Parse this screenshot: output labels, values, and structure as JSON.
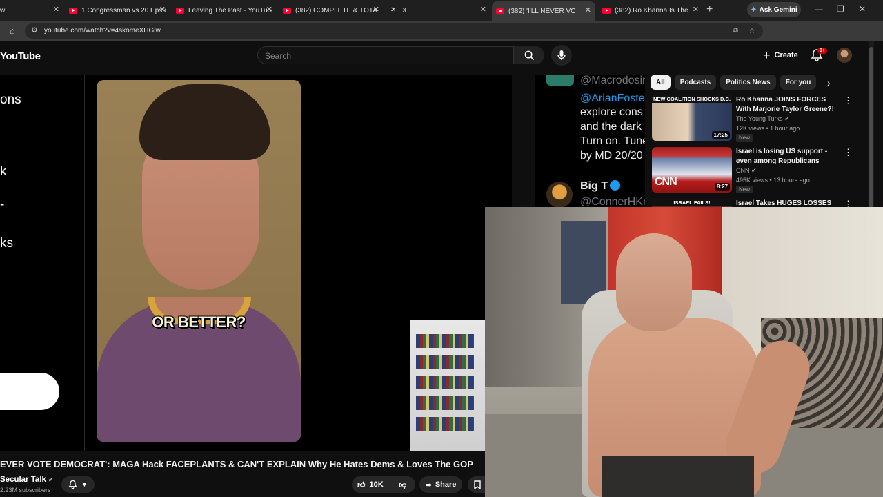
{
  "browser": {
    "tabs": [
      {
        "title": "w",
        "icon": "close-icon",
        "active": false
      },
      {
        "title": "1 Congressman vs 20 Epstein",
        "icon": "youtube-icon",
        "active": false
      },
      {
        "title": "Leaving The Past - YouTube",
        "icon": "youtube-icon",
        "active": false
      },
      {
        "title": "(382) COMPLETE & TOTAL H",
        "icon": "youtube-icon",
        "active": false
      },
      {
        "title": "X",
        "icon": "x-icon",
        "active": false
      },
      {
        "title": "(382) 'I'LL NEVER VOTE D",
        "icon": "youtube-icon",
        "active": true
      },
      {
        "title": "(382) Ro Khanna Is The TRU",
        "icon": "youtube-icon",
        "active": false
      }
    ],
    "ask_gemini": "Ask Gemini",
    "url": "youtube.com/watch?v=4skomeXHGlw"
  },
  "youtube": {
    "logo": "YouTube",
    "search_placeholder": "Search",
    "create_label": "Create",
    "notifications_badge": "9+"
  },
  "player": {
    "left_fragments": [
      "ons",
      "k",
      "-",
      "ks"
    ],
    "caption": "OR BETTER?"
  },
  "video": {
    "title": "EVER VOTE DEMOCRAT': MAGA Hack FACEPLANTS & CAN'T EXPLAIN Why He Hates Dems & Loves The GOP",
    "channel": "Secular Talk",
    "subscribers": "2.23M subscribers",
    "likes": "10K",
    "share_label": "Share"
  },
  "tweet": {
    "handle1": "@Macrodosin",
    "mention": "@ArianFoster",
    "lines": [
      "explore cons",
      "and the dark",
      "Turn on. Tune",
      "by MD 20/20"
    ],
    "name2": "Big T",
    "handle2": "@ConnerHKr"
  },
  "recommendations": {
    "chips": [
      "All",
      "Podcasts",
      "Politics News",
      "For you"
    ],
    "selected_chip": "All",
    "items": [
      {
        "title": "Ro Khanna JOINS FORCES With Marjorie Taylor Greene?!",
        "channel": "The Young Turks",
        "meta": "12K views • 1 hour ago",
        "badge": "New",
        "duration": "17:25",
        "banner": "NEW COALITION SHOCKS D.C."
      },
      {
        "title": "Israel is losing US support - even among Republicans",
        "channel": "CNN",
        "meta": "495K views • 13 hours ago",
        "badge": "New",
        "duration": "8:27",
        "banner": "CNN"
      },
      {
        "title": "Israel Takes HUGES LOSSES",
        "banner": "ISRAEL FAILS!"
      }
    ]
  },
  "colors": {
    "youtube_red": "#ff0033",
    "chip_selected": "#f1f1f1",
    "tweet_blue": "#1d9bf0",
    "caption_color": "#f7f2d8"
  }
}
